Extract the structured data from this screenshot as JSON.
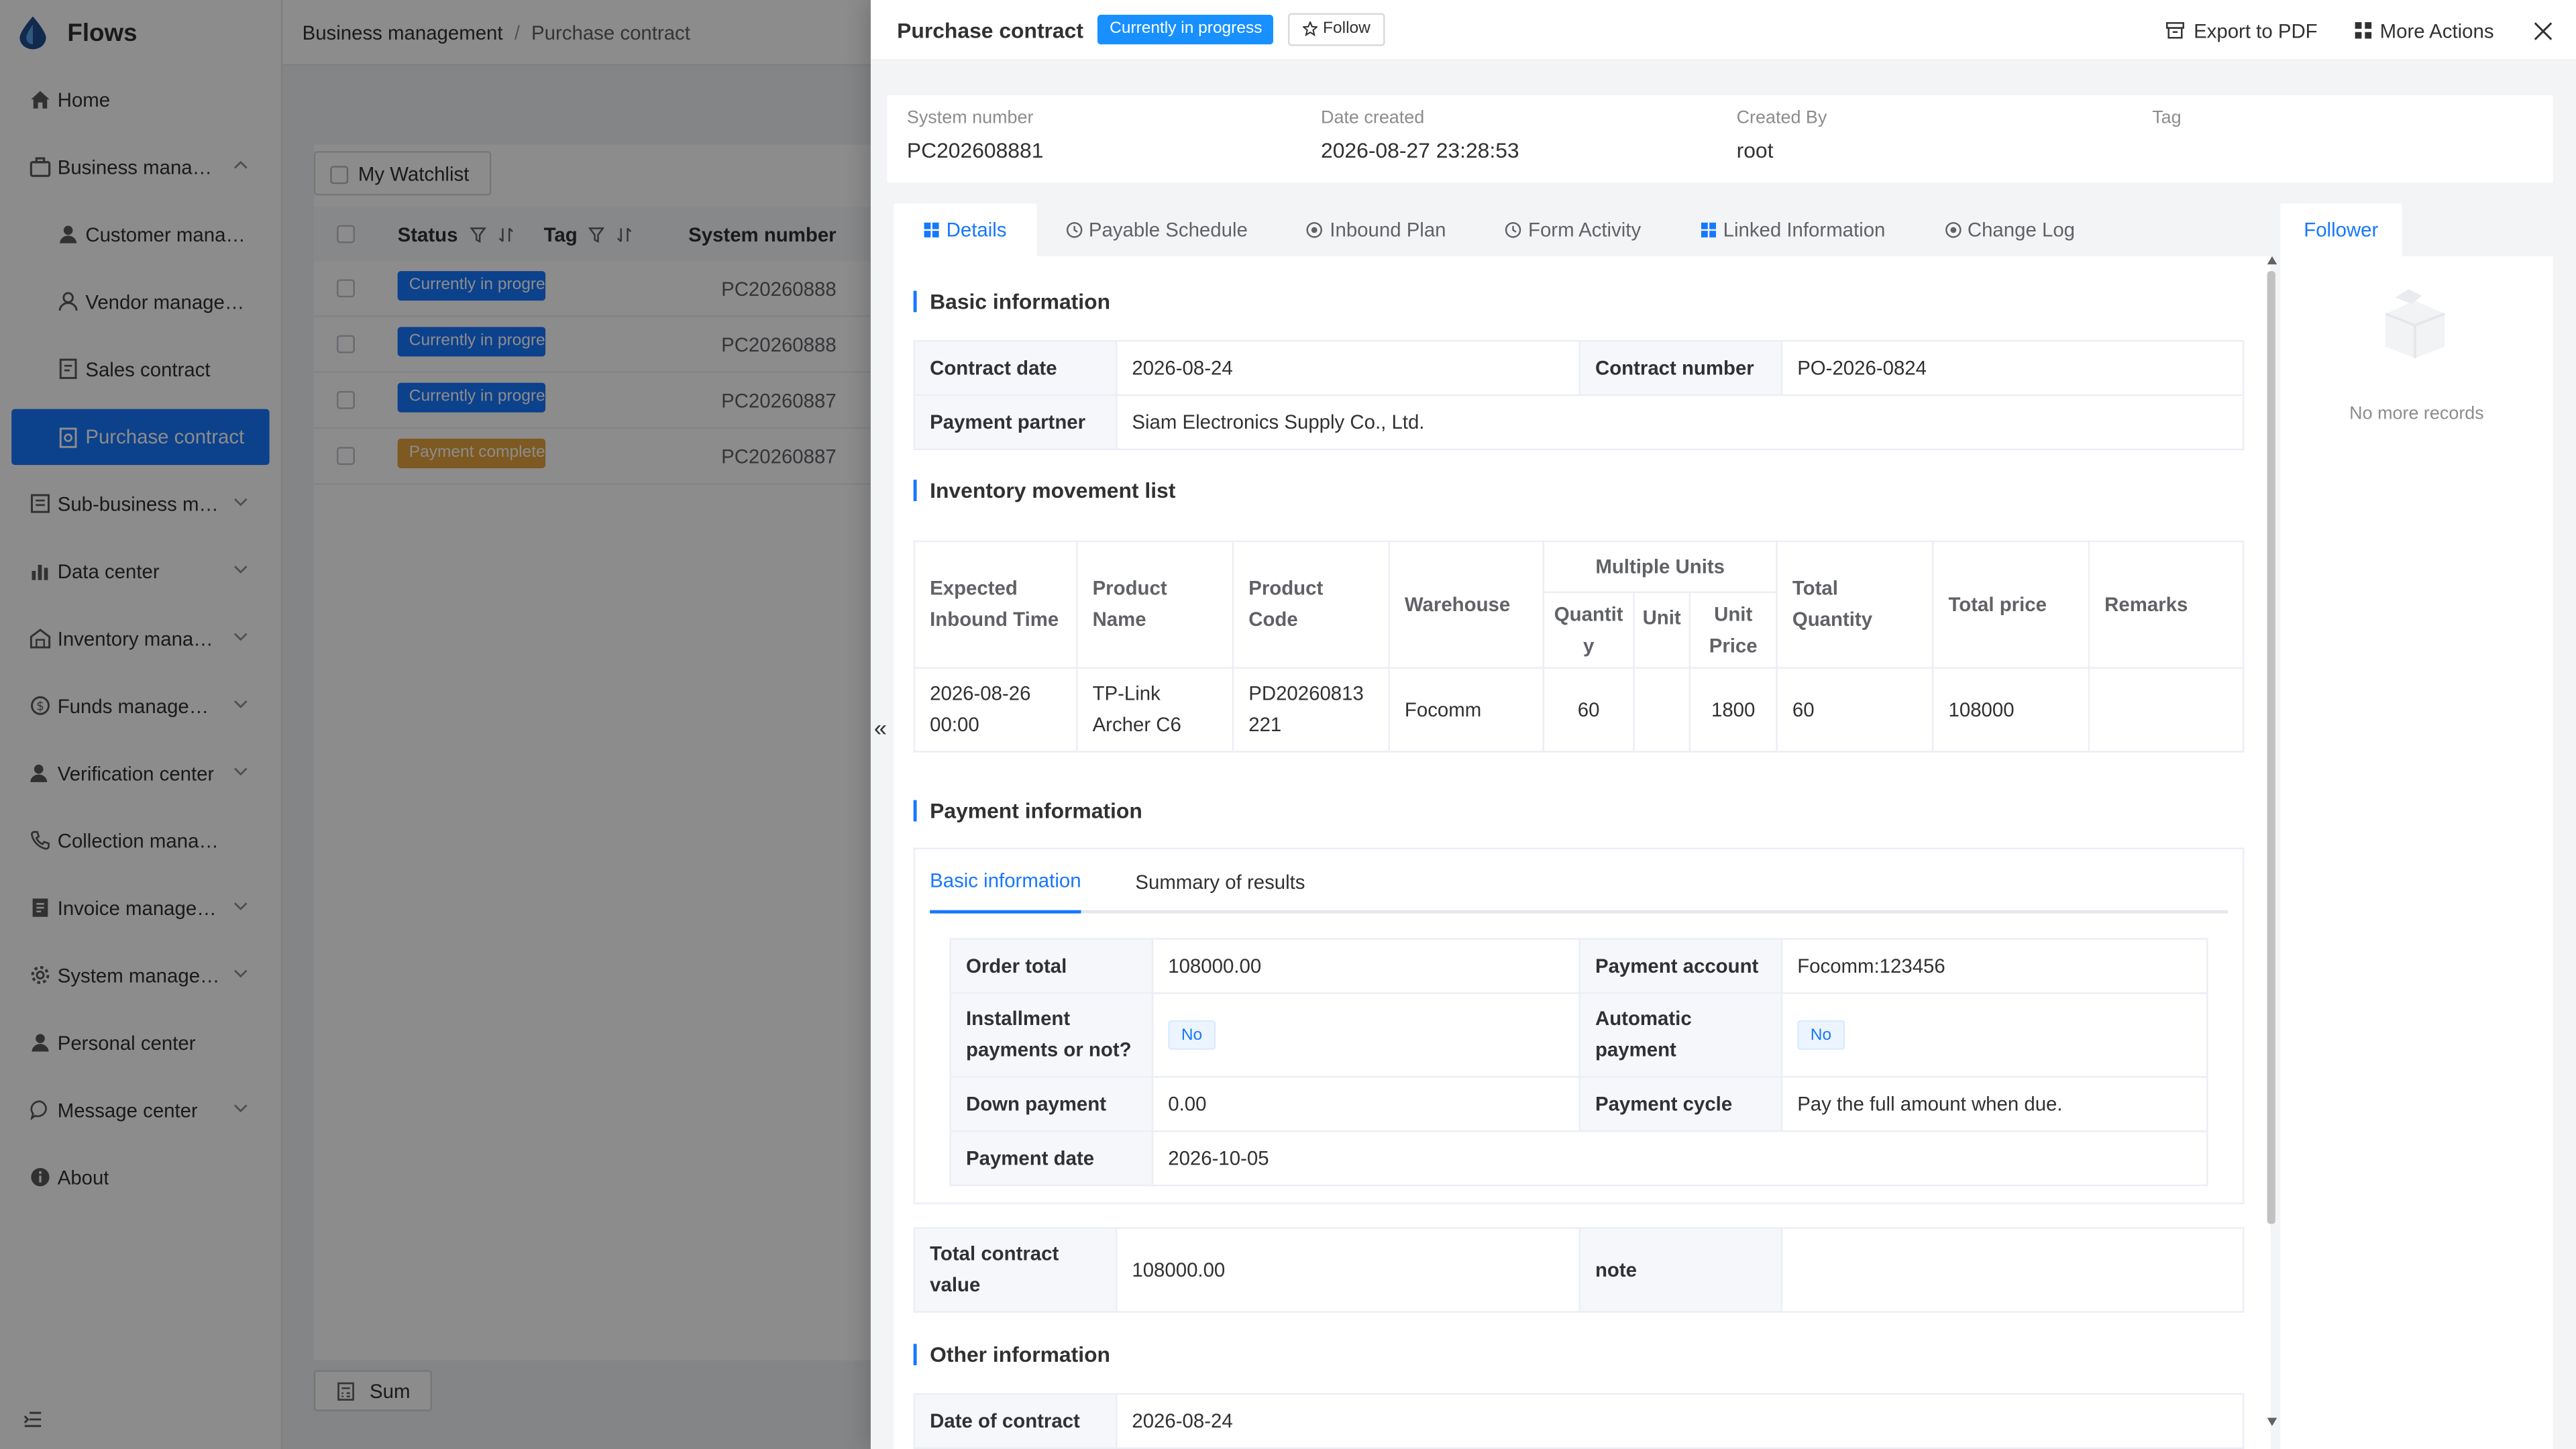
{
  "app": {
    "name": "Flows"
  },
  "sidebar": {
    "items": [
      {
        "label": "Home",
        "icon": "home-icon"
      },
      {
        "label": "Business manag…",
        "icon": "briefcase-icon"
      },
      {
        "label": "Customer manag…",
        "icon": "user-icon"
      },
      {
        "label": "Vendor managem…",
        "icon": "vendor-icon"
      },
      {
        "label": "Sales contract",
        "icon": "contract-icon"
      },
      {
        "label": "Purchase contract",
        "icon": "purchase-icon"
      },
      {
        "label": "Sub-business m…",
        "icon": "sub-business-icon"
      },
      {
        "label": "Data center",
        "icon": "bar-chart-icon"
      },
      {
        "label": "Inventory manag…",
        "icon": "warehouse-icon"
      },
      {
        "label": "Funds managem…",
        "icon": "coin-icon"
      },
      {
        "label": "Verification center",
        "icon": "verify-user-icon"
      },
      {
        "label": "Collection managem…",
        "icon": "phone-icon"
      },
      {
        "label": "Invoice manage…",
        "icon": "invoice-icon"
      },
      {
        "label": "System manage…",
        "icon": "gear-icon"
      },
      {
        "label": "Personal center",
        "icon": "person-icon"
      },
      {
        "label": "Message center",
        "icon": "message-icon"
      },
      {
        "label": "About",
        "icon": "info-icon"
      }
    ]
  },
  "breadcrumb": {
    "first": "Business management",
    "separator": "/",
    "second": "Purchase contract"
  },
  "list": {
    "watchlist_label": "My Watchlist",
    "columns": {
      "status": "Status",
      "tag": "Tag",
      "system_number": "System number"
    },
    "rows": [
      {
        "status": "Currently in progress",
        "system_number": "PC20260888"
      },
      {
        "status": "Currently in progress",
        "system_number": "PC20260888"
      },
      {
        "status": "Currently in progress",
        "system_number": "PC20260887"
      },
      {
        "status": "Payment completed",
        "system_number": "PC20260887"
      }
    ],
    "sum_label": "Sum"
  },
  "drawer": {
    "title": "Purchase contract",
    "status": "Currently in progress",
    "follow_label": "Follow",
    "export_label": "Export to PDF",
    "more_label": "More Actions",
    "summary": {
      "system_number_label": "System number",
      "system_number": "PC202608881",
      "date_created_label": "Date created",
      "date_created": "2026-08-27 23:28:53",
      "created_by_label": "Created By",
      "created_by": "root",
      "tag_label": "Tag"
    },
    "tabs": [
      "Details",
      "Payable Schedule",
      "Inbound Plan",
      "Form Activity",
      "Linked Information",
      "Change Log"
    ],
    "follower_tab": "Follower",
    "no_records": "No more records",
    "collapse_glyph": "«",
    "basic": {
      "title": "Basic information",
      "contract_date_label": "Contract date",
      "contract_date": "2026-08-24",
      "contract_number_label": "Contract number",
      "contract_number": "PO-2026-0824",
      "payment_partner_label": "Payment partner",
      "payment_partner": "Siam Electronics Supply Co., Ltd."
    },
    "inventory": {
      "title": "Inventory movement list",
      "headers": {
        "expected": "Expected Inbound Time",
        "product_name": "Product Name",
        "product_code": "Product Code",
        "warehouse": "Warehouse",
        "multiple_units": "Multiple Units",
        "quantity": "Quantity",
        "unit": "Unit",
        "unit_price": "Unit Price",
        "total_quantity": "Total Quantity",
        "total_price": "Total price",
        "remarks": "Remarks"
      },
      "row": {
        "expected": "2026-08-26 00:00",
        "product_name": "TP-Link Archer C6",
        "product_code": "PD20260813221",
        "warehouse": "Focomm",
        "quantity": "60",
        "unit": "",
        "unit_price": "1800",
        "total_quantity": "60",
        "total_price": "108000",
        "remarks": ""
      }
    },
    "payment": {
      "title": "Payment information",
      "tab_basic": "Basic information",
      "tab_summary": "Summary of results",
      "order_total_label": "Order total",
      "order_total": "108000.00",
      "payment_account_label": "Payment account",
      "payment_account": "Focomm:123456",
      "installment_label": "Installment payments or not?",
      "installment": "No",
      "automatic_label": "Automatic payment",
      "automatic": "No",
      "down_payment_label": "Down payment",
      "down_payment": "0.00",
      "payment_cycle_label": "Payment cycle",
      "payment_cycle": "Pay the full amount when due.",
      "payment_date_label": "Payment date",
      "payment_date": "2026-10-05"
    },
    "totals": {
      "total_label": "Total contract value",
      "total": "108000.00",
      "note_label": "note",
      "note": ""
    },
    "other": {
      "title": "Other information",
      "date_label": "Date of contract",
      "date": "2026-08-24"
    }
  },
  "colors": {
    "accent": "#1677ff",
    "warning": "#e6a23c"
  }
}
